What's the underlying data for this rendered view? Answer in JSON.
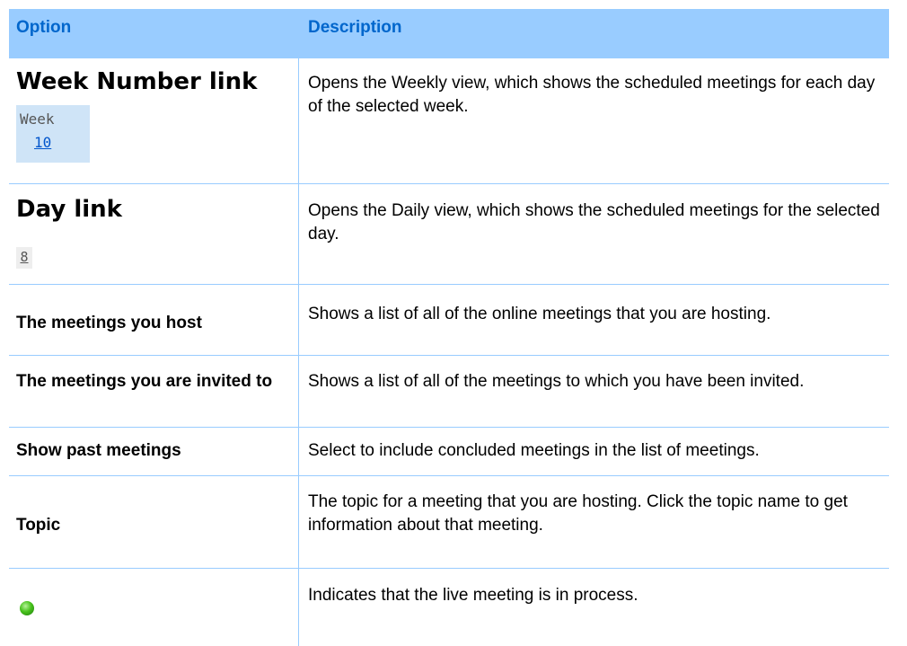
{
  "header": {
    "option": "Option",
    "description": "Description"
  },
  "rows": [
    {
      "option": "Week Number link",
      "icon_text": [
        "Week",
        "10"
      ],
      "description": "Opens the Weekly view, which shows the scheduled meetings for each day of the selected week."
    },
    {
      "option": "Day link",
      "icon_text": [
        "8"
      ],
      "description": "Opens the Daily view, which shows the scheduled meetings for the selected day."
    },
    {
      "option": "The meetings you host",
      "description": "Shows a list of all of the online meetings that you are hosting."
    },
    {
      "option": "The meetings you are invited to",
      "description": "Shows a list of all of the meetings to which you have been invited."
    },
    {
      "option": "Show past meetings",
      "description": "Select to include concluded meetings in the list of meetings."
    },
    {
      "option": "Topic",
      "description": "The topic for a meeting that you are hosting. Click the topic name to get information about that meeting."
    },
    {
      "option": "",
      "icon": "green-status-dot-icon",
      "description": "Indicates that the live meeting is in process."
    }
  ],
  "colors": {
    "header_bg": "#99ccff",
    "header_text": "#0066cc",
    "rule": "#99ccff",
    "live_dot": "#48c21c"
  }
}
